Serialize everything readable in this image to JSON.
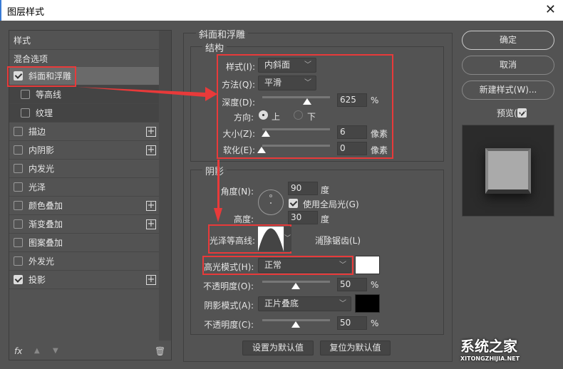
{
  "window": {
    "title": "图层样式",
    "close": "✕"
  },
  "sidebar": {
    "items": [
      {
        "label": "样式",
        "check": null,
        "plus": false
      },
      {
        "label": "混合选项",
        "check": null,
        "plus": false
      },
      {
        "label": "斜面和浮雕",
        "check": true,
        "plus": false,
        "selected": true
      },
      {
        "label": "等高线",
        "check": false,
        "plus": false,
        "sub": true
      },
      {
        "label": "纹理",
        "check": false,
        "plus": false,
        "sub": true
      },
      {
        "label": "描边",
        "check": false,
        "plus": true
      },
      {
        "label": "内阴影",
        "check": false,
        "plus": true
      },
      {
        "label": "内发光",
        "check": false,
        "plus": false
      },
      {
        "label": "光泽",
        "check": false,
        "plus": false
      },
      {
        "label": "颜色叠加",
        "check": false,
        "plus": true
      },
      {
        "label": "渐变叠加",
        "check": false,
        "plus": true
      },
      {
        "label": "图案叠加",
        "check": false,
        "plus": false
      },
      {
        "label": "外发光",
        "check": false,
        "plus": false
      },
      {
        "label": "投影",
        "check": true,
        "plus": true
      }
    ],
    "fx": "fx",
    "up": "▲",
    "down": "▼",
    "trash": "🗑"
  },
  "bevel": {
    "title": "斜面和浮雕",
    "structure": {
      "title": "结构",
      "style_label": "样式(I):",
      "style_value": "内斜面",
      "technique_label": "方法(Q):",
      "technique_value": "平滑",
      "depth_label": "深度(D):",
      "depth_value": "625",
      "depth_unit": "%",
      "depth_pct": 0.6,
      "direction_label": "方向:",
      "dir_up": "上",
      "dir_down": "下",
      "size_label": "大小(Z):",
      "size_value": "6",
      "size_unit": "像素",
      "soften_label": "软化(E):",
      "soften_value": "0",
      "soften_unit": "像素"
    },
    "shading": {
      "title": "阴影",
      "angle_label": "角度(N):",
      "angle_value": "90",
      "angle_unit": "度",
      "global_light": "使用全局光(G)",
      "altitude_label": "高度:",
      "altitude_value": "30",
      "altitude_unit": "度",
      "gloss_label": "光泽等高线:",
      "antialias": "消除锯齿(L)",
      "highlight_label": "高光模式(H):",
      "highlight_value": "正常",
      "highlight_color": "#ffffff",
      "opacity1_label": "不透明度(O):",
      "opacity1_value": "50",
      "opacity1_unit": "%",
      "shadow_label": "阴影模式(A):",
      "shadow_value": "正片叠底",
      "shadow_color": "#000000",
      "opacity2_label": "不透明度(C):",
      "opacity2_value": "50",
      "opacity2_unit": "%"
    },
    "make_default": "设置为默认值",
    "reset_default": "复位为默认值"
  },
  "actions": {
    "ok": "确定",
    "cancel": "取消",
    "new_style": "新建样式(W)...",
    "preview": "预览(V)"
  },
  "watermark": {
    "cn": "系统之家",
    "en": "XITONGZHIJIA.NET"
  },
  "colors": {
    "annotation": "#e83a3a",
    "background": "#535353"
  }
}
